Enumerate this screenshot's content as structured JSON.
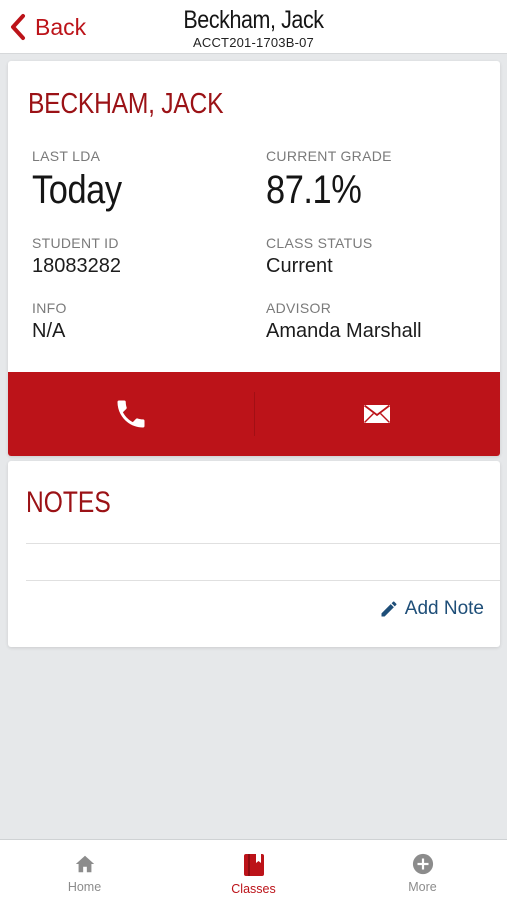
{
  "header": {
    "back_label": "Back",
    "title": "Beckham, Jack",
    "subtitle": "ACCT201-1703B-07"
  },
  "student": {
    "name": "BECKHAM, JACK",
    "fields": {
      "last_lda_label": "LAST LDA",
      "last_lda_value": "Today",
      "current_grade_label": "CURRENT GRADE",
      "current_grade_value": "87.1%",
      "student_id_label": "STUDENT ID",
      "student_id_value": "18083282",
      "class_status_label": "CLASS STATUS",
      "class_status_value": "Current",
      "info_label": "INFO",
      "info_value": "N/A",
      "advisor_label": "ADVISOR",
      "advisor_value": "Amanda Marshall"
    },
    "actions": [
      {
        "icon": "phone-icon"
      },
      {
        "icon": "mail-icon"
      }
    ]
  },
  "notes": {
    "title": "NOTES",
    "add_note_label": "Add Note",
    "add_note_icon": "pencil-icon"
  },
  "tabbar": {
    "tabs": [
      {
        "label": "Home",
        "icon": "home-icon",
        "active": false
      },
      {
        "label": "Classes",
        "icon": "book-icon",
        "active": true
      },
      {
        "label": "More",
        "icon": "plus-circle-icon",
        "active": false
      }
    ]
  },
  "colors": {
    "brand_red": "#bc1319",
    "title_red": "#9b1216",
    "link_blue": "#1e4e78",
    "inactive_gray": "#8c8c8c",
    "background": "#e6e8ea"
  }
}
